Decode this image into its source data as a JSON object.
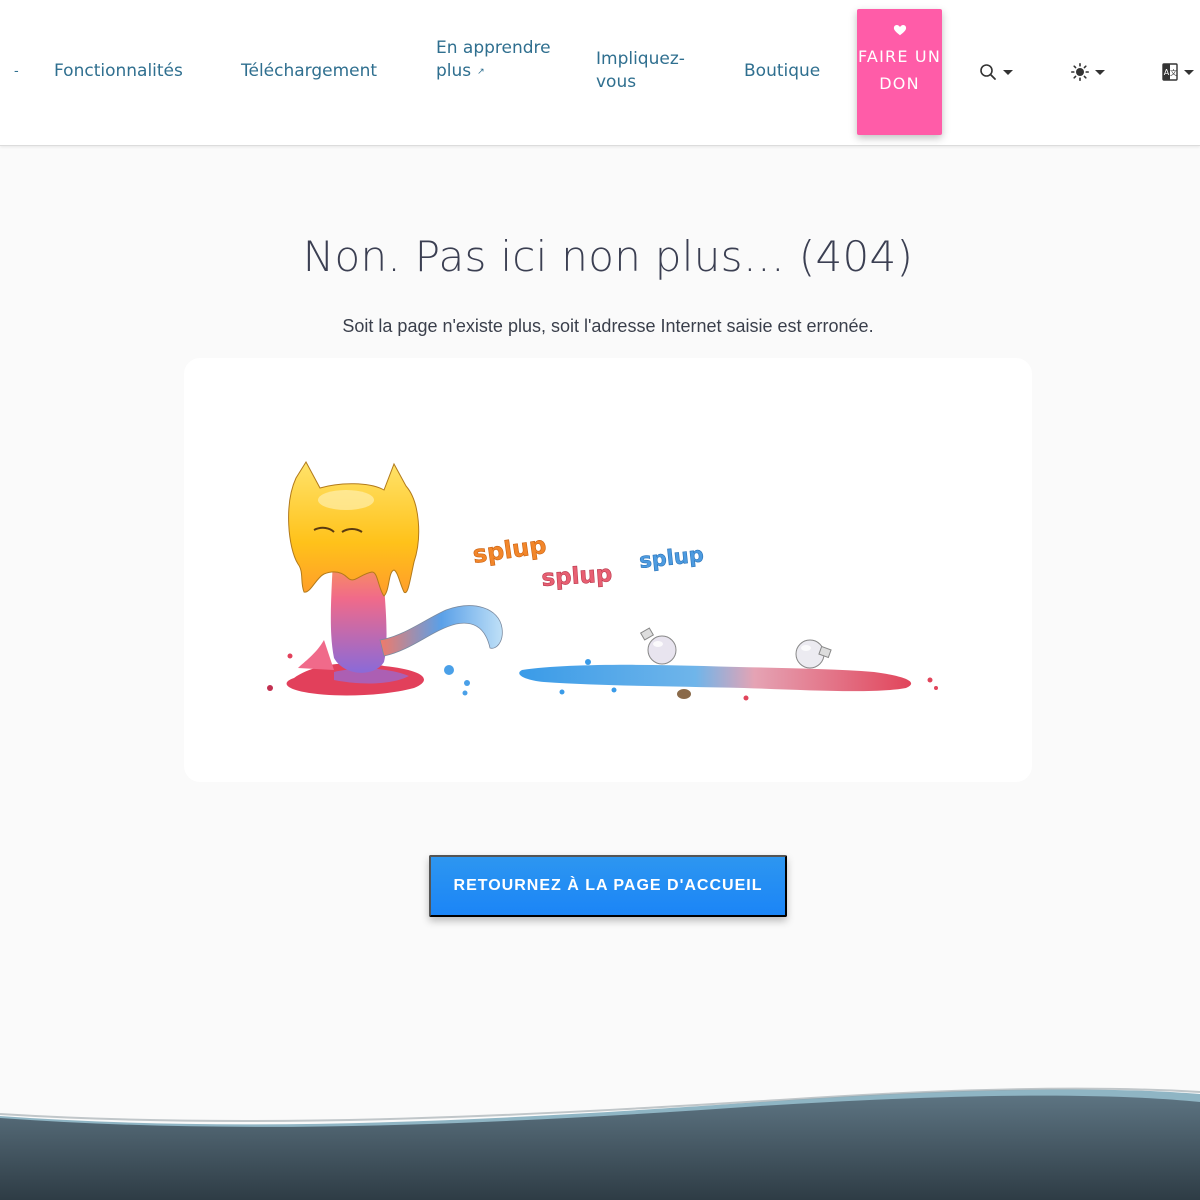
{
  "nav": {
    "dash": "-",
    "features": "Fonctionnalités",
    "download": "Téléchargement",
    "learn_more": "En apprendre plus",
    "get_involved": "Impliquez-vous",
    "shop": "Boutique",
    "donate": "Faire un don"
  },
  "icons": {
    "donate": "heart-icon",
    "learn_more": "external-link-icon",
    "search": "search-icon",
    "theme": "sun-icon",
    "language": "language-icon",
    "dropdown": "caret-down-icon"
  },
  "main": {
    "title": "Non. Pas ici non plus… (404)",
    "subtitle": "Soit la page n'existe plus, soit l'adresse Internet saisie est erronée.",
    "home_button": "RETOURNEZ À LA PAGE D'ACCUEIL"
  },
  "illustration": {
    "sounds": [
      "splup",
      "splup",
      "splup"
    ]
  },
  "colors": {
    "nav_link": "#2f6f8f",
    "donate_bg": "#ff5ca8",
    "home_button_bg": "#1b85f7",
    "page_bg": "#fafafa",
    "footer_wave": "#4a5f6b"
  }
}
